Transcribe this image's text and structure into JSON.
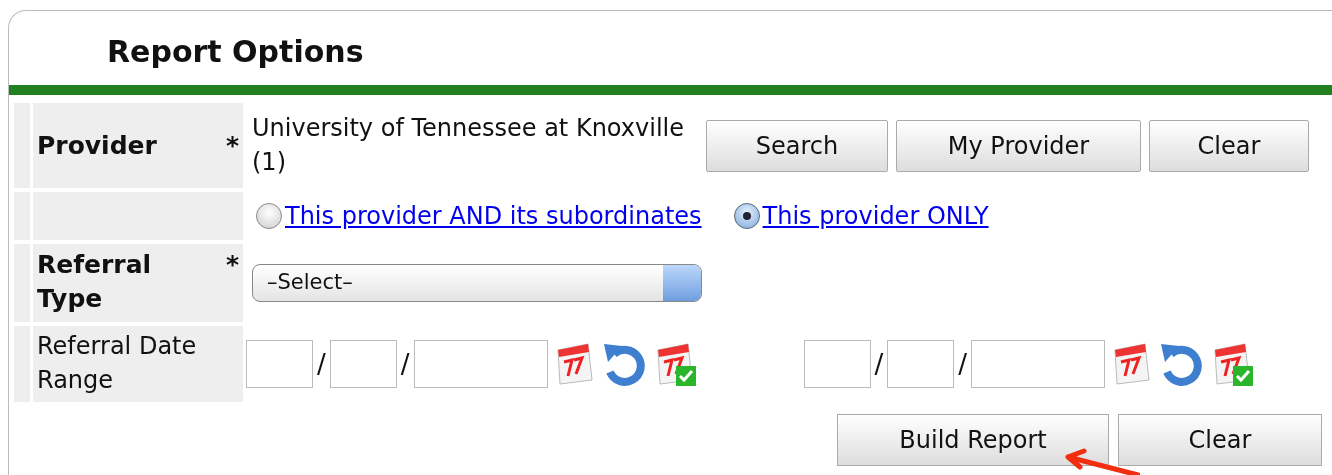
{
  "title": "Report Options",
  "fields": [
    {
      "kind": "provider",
      "label": "Provider",
      "required_mark": "*",
      "value": "University of Tennessee at Knoxville (1)",
      "buttons": [
        "Search",
        "My Provider",
        "Clear"
      ]
    },
    {
      "kind": "scope",
      "options": [
        {
          "label": "This provider AND its subordinates",
          "selected": false
        },
        {
          "label": "This provider ONLY",
          "selected": true
        }
      ]
    },
    {
      "kind": "select",
      "label": "Referral Type",
      "required_mark": "*",
      "value": "–Select–"
    },
    {
      "kind": "daterange",
      "label": "Referral Date Range",
      "dates": [
        {
          "separators": [
            "/",
            "/"
          ]
        },
        {
          "separators": [
            "/",
            "/"
          ]
        }
      ]
    }
  ],
  "actions": [
    "Build Report",
    "Clear"
  ]
}
